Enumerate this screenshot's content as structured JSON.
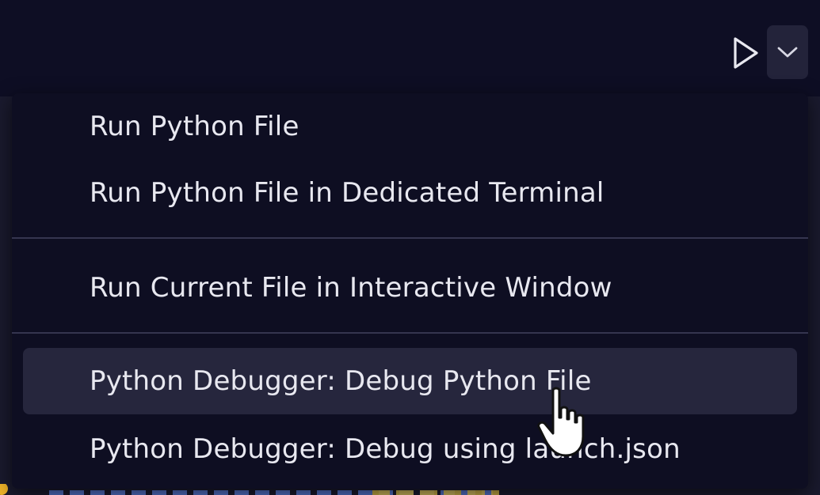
{
  "toolbar": {
    "run_icon": "play-icon",
    "dropdown_icon": "chevron-down-icon"
  },
  "menu": {
    "items": [
      {
        "label": "Run Python File",
        "highlighted": false
      },
      {
        "label": "Run Python File in Dedicated Terminal",
        "highlighted": false
      },
      {
        "label": "Run Current File in Interactive Window",
        "highlighted": false
      },
      {
        "label": "Python Debugger: Debug Python File",
        "highlighted": true
      },
      {
        "label": "Python Debugger: Debug using launch.json",
        "highlighted": false
      }
    ]
  },
  "colors": {
    "background": "#0e0e24",
    "menu_background": "#0e0e22",
    "highlight": "#26263d",
    "text": "#e8e8f0",
    "separator": "#35354f"
  }
}
